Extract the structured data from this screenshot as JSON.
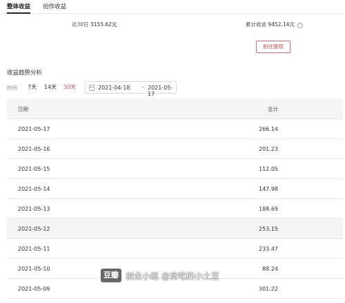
{
  "tabs": [
    {
      "label": "整体收益",
      "active": true
    },
    {
      "label": "创作收益",
      "active": false
    }
  ],
  "stats": {
    "recent30_label": "近30日",
    "recent30_value": "3155.62元",
    "total_label": "累计收益",
    "total_value": "9452.14元",
    "help_icon": "question-circle-icon"
  },
  "withdraw_button": "前往提现",
  "trend": {
    "title": "收益趋势分析",
    "time_label": "时间",
    "ranges": [
      "7天",
      "14天",
      "30天"
    ],
    "active_range": "30天",
    "date_start": "2021-04-18",
    "date_separator": "~",
    "date_end": "2021-05-17",
    "calendar_icon": "calendar-icon"
  },
  "table": {
    "headers": {
      "date": "日期",
      "total": "总计"
    },
    "rows": [
      {
        "date": "2021-05-17",
        "total": "266.14"
      },
      {
        "date": "2021-05-16",
        "total": "201.23"
      },
      {
        "date": "2021-05-15",
        "total": "112.05"
      },
      {
        "date": "2021-05-14",
        "total": "147.98"
      },
      {
        "date": "2021-05-13",
        "total": "188.69"
      },
      {
        "date": "2021-05-12",
        "total": "253.15"
      },
      {
        "date": "2021-05-11",
        "total": "233.47"
      },
      {
        "date": "2021-05-10",
        "total": "88.24"
      },
      {
        "date": "2021-05-09",
        "total": "301.22"
      }
    ]
  },
  "watermark": {
    "logo": "豆瓣",
    "text": "创业小组 @贪吃的小土豆"
  },
  "colors": {
    "accent": "#c94b4b",
    "header_bg": "#f5f5f5",
    "border": "#e8e8e8"
  }
}
